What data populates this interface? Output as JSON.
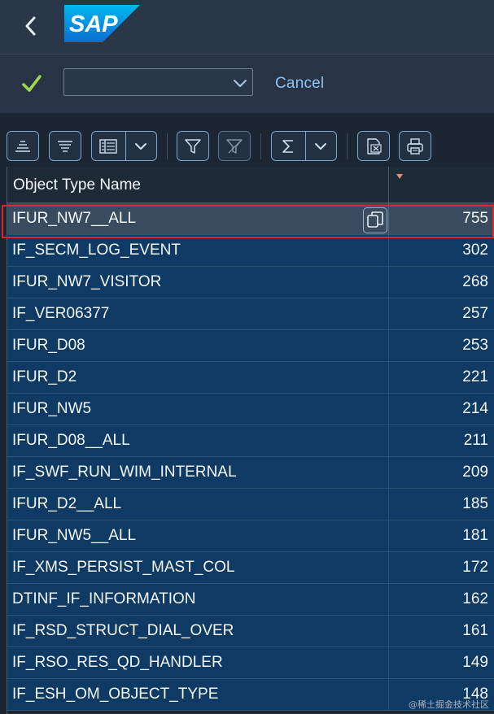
{
  "header": {
    "back_icon": "chevron-left-icon",
    "logo_text": "SAP",
    "logo_color": "#0a6ed1"
  },
  "actionbar": {
    "confirm_icon": "checkmark-icon",
    "confirm_color": "#9fd84a",
    "select_value": "",
    "select_icon": "chevron-down-icon",
    "cancel_label": "Cancel"
  },
  "toolbar": {
    "buttons": [
      "sort-ascending-icon",
      "sort-descending-icon",
      "layout-icon",
      "chevron-down-icon",
      "filter-icon",
      "clear-filter-icon",
      "sum-icon",
      "chevron-down-icon",
      "export-excel-icon",
      "print-icon"
    ]
  },
  "table": {
    "columns": [
      "Object Type Name",
      ""
    ],
    "rows": [
      {
        "name": "IFUR_NW7__ALL",
        "count": "755"
      },
      {
        "name": "IF_SECM_LOG_EVENT",
        "count": "302"
      },
      {
        "name": "IFUR_NW7_VISITOR",
        "count": "268"
      },
      {
        "name": "IF_VER06377",
        "count": "257"
      },
      {
        "name": "IFUR_D08",
        "count": "253"
      },
      {
        "name": "IFUR_D2",
        "count": "221"
      },
      {
        "name": "IFUR_NW5",
        "count": "214"
      },
      {
        "name": "IFUR_D08__ALL",
        "count": "211"
      },
      {
        "name": "IF_SWF_RUN_WIM_INTERNAL",
        "count": "209"
      },
      {
        "name": "IFUR_D2__ALL",
        "count": "185"
      },
      {
        "name": "IFUR_NW5__ALL",
        "count": "181"
      },
      {
        "name": "IF_XMS_PERSIST_MAST_COL",
        "count": "172"
      },
      {
        "name": "DTINF_IF_INFORMATION",
        "count": "162"
      },
      {
        "name": "IF_RSD_STRUCT_DIAL_OVER",
        "count": "161"
      },
      {
        "name": "IF_RSO_RES_QD_HANDLER",
        "count": "149"
      },
      {
        "name": "IF_ESH_OM_OBJECT_TYPE",
        "count": "148"
      }
    ],
    "selected_row": 0,
    "copy_icon": "copy-icon",
    "sort_indicator_color": "#f08a7a",
    "row_color": "#0e3a63"
  },
  "watermark": "@稀土掘金技术社区"
}
